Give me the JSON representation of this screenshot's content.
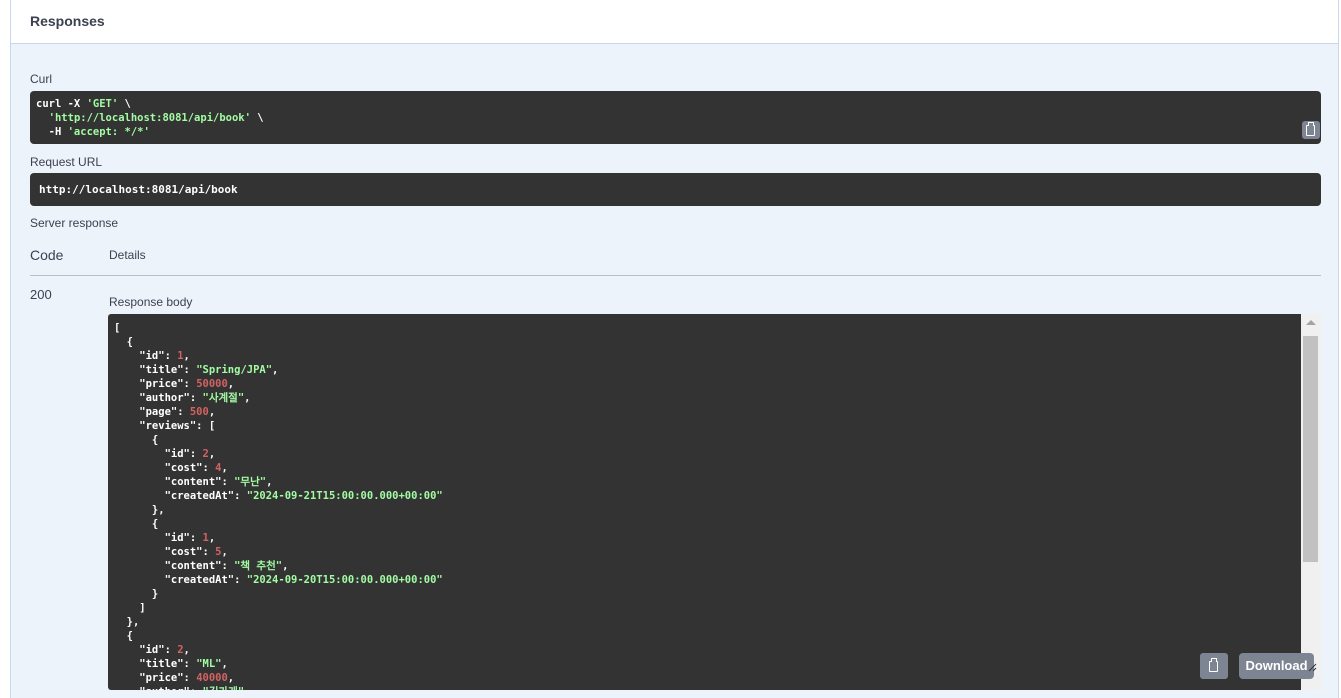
{
  "header": {
    "title": "Responses"
  },
  "curl": {
    "label": "Curl",
    "lines": [
      {
        "cmd": "curl -X ",
        "str": "'GET'",
        "tail": " \\"
      },
      {
        "cmd": "  ",
        "str": "'http://localhost:8081/api/book'",
        "tail": " \\"
      },
      {
        "cmd": "  -H ",
        "str": "'accept: */*'",
        "tail": ""
      }
    ]
  },
  "request_url": {
    "label": "Request URL",
    "value": "http://localhost:8081/api/book"
  },
  "server_response": {
    "label": "Server response",
    "code_header": "Code",
    "details_header": "Details",
    "code": "200",
    "body_label": "Response body"
  },
  "response_body": [
    [
      {
        "t": "["
      }
    ],
    [
      {
        "t": "  {"
      }
    ],
    [
      {
        "t": "    \"id\": "
      },
      {
        "t": "1",
        "c": "num"
      },
      {
        "t": ","
      }
    ],
    [
      {
        "t": "    \"title\": "
      },
      {
        "t": "\"Spring/JPA\"",
        "c": "str"
      },
      {
        "t": ","
      }
    ],
    [
      {
        "t": "    \"price\": "
      },
      {
        "t": "50000",
        "c": "num"
      },
      {
        "t": ","
      }
    ],
    [
      {
        "t": "    \"author\": "
      },
      {
        "t": "\"사계절\"",
        "c": "str"
      },
      {
        "t": ","
      }
    ],
    [
      {
        "t": "    \"page\": "
      },
      {
        "t": "500",
        "c": "num"
      },
      {
        "t": ","
      }
    ],
    [
      {
        "t": "    \"reviews\": ["
      }
    ],
    [
      {
        "t": "      {"
      }
    ],
    [
      {
        "t": "        \"id\": "
      },
      {
        "t": "2",
        "c": "num"
      },
      {
        "t": ","
      }
    ],
    [
      {
        "t": "        \"cost\": "
      },
      {
        "t": "4",
        "c": "num"
      },
      {
        "t": ","
      }
    ],
    [
      {
        "t": "        \"content\": "
      },
      {
        "t": "\"무난\"",
        "c": "str"
      },
      {
        "t": ","
      }
    ],
    [
      {
        "t": "        \"createdAt\": "
      },
      {
        "t": "\"2024-09-21T15:00:00.000+00:00\"",
        "c": "str"
      }
    ],
    [
      {
        "t": "      },"
      }
    ],
    [
      {
        "t": "      {"
      }
    ],
    [
      {
        "t": "        \"id\": "
      },
      {
        "t": "1",
        "c": "num"
      },
      {
        "t": ","
      }
    ],
    [
      {
        "t": "        \"cost\": "
      },
      {
        "t": "5",
        "c": "num"
      },
      {
        "t": ","
      }
    ],
    [
      {
        "t": "        \"content\": "
      },
      {
        "t": "\"책 추천\"",
        "c": "str"
      },
      {
        "t": ","
      }
    ],
    [
      {
        "t": "        \"createdAt\": "
      },
      {
        "t": "\"2024-09-20T15:00:00.000+00:00\"",
        "c": "str"
      }
    ],
    [
      {
        "t": "      }"
      }
    ],
    [
      {
        "t": "    ]"
      }
    ],
    [
      {
        "t": "  },"
      }
    ],
    [
      {
        "t": "  {"
      }
    ],
    [
      {
        "t": "    \"id\": "
      },
      {
        "t": "2",
        "c": "num"
      },
      {
        "t": ","
      }
    ],
    [
      {
        "t": "    \"title\": "
      },
      {
        "t": "\"ML\"",
        "c": "str"
      },
      {
        "t": ","
      }
    ],
    [
      {
        "t": "    \"price\": "
      },
      {
        "t": "40000",
        "c": "num"
      },
      {
        "t": ","
      }
    ],
    [
      {
        "t": "    \"author\": "
      },
      {
        "t": "\"길가게\"",
        "c": "str"
      },
      {
        "t": ","
      }
    ]
  ],
  "buttons": {
    "download": "Download"
  },
  "icons": {
    "copy": "clipboard-copy-icon",
    "download_resize": "resize-handle-icon"
  },
  "colors": {
    "panel_bg": "#ecf3fb",
    "code_bg": "#333333",
    "string": "#a2fca2",
    "number": "#d36363",
    "button": "#7d8492"
  }
}
